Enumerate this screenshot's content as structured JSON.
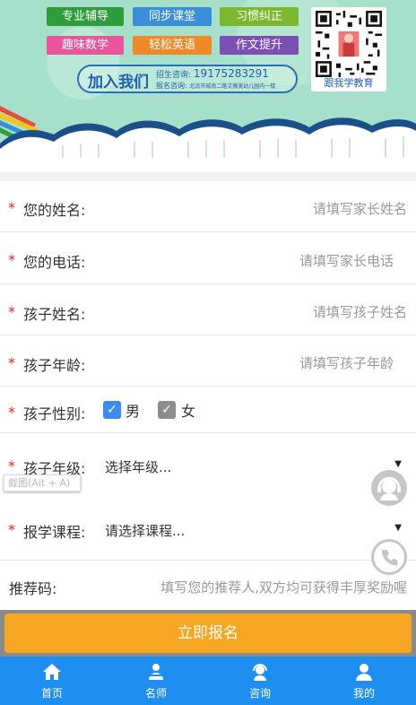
{
  "banner": {
    "tags": [
      "专业辅导",
      "同步课堂",
      "习惯纠正",
      "趣味数学",
      "轻松英语",
      "作文提升"
    ],
    "join_title": "加入我们",
    "enroll_label": "招生咨询:",
    "enroll_phone": "19175283291",
    "signup_label": "报名咨询:",
    "signup_address": "北流市城南二路艾薇美幼儿园内一楼",
    "qr_label": "跟我学教育"
  },
  "form": {
    "rows": [
      {
        "label": "您的姓名:",
        "placeholder": "请填写家长姓名",
        "required": "*"
      },
      {
        "label": "您的电话:",
        "placeholder": "请填写家长电话",
        "required": "*"
      },
      {
        "label": "孩子姓名:",
        "placeholder": "请填写孩子姓名",
        "required": "*"
      },
      {
        "label": "孩子年龄:",
        "placeholder": "请填写孩子年龄",
        "required": "*"
      }
    ],
    "gender": {
      "label": "孩子性别:",
      "required": "*",
      "male": "男",
      "female": "女",
      "male_checked": true,
      "female_checked": true
    },
    "grade": {
      "label": "孩子年级:",
      "required": "*",
      "selected": "选择年级..."
    },
    "course": {
      "label": "报学课程:",
      "required": "*",
      "selected": "请选择课程..."
    },
    "referral": {
      "label": "推荐码:",
      "placeholder": "填写您的推荐人,双方均可获得丰厚奖励喔"
    },
    "submit_label": "立即报名"
  },
  "tooltip": "截图(Alt + A)",
  "tabs": [
    {
      "label": "首页",
      "icon": "home-icon"
    },
    {
      "label": "名师",
      "icon": "teacher-icon"
    },
    {
      "label": "咨询",
      "icon": "headset-icon"
    },
    {
      "label": "我的",
      "icon": "user-icon"
    }
  ],
  "colors": {
    "accent": "#1e8ff0",
    "submit": "#f5a623",
    "required": "#e0251b",
    "banner_bg": "#a6e0cb"
  }
}
